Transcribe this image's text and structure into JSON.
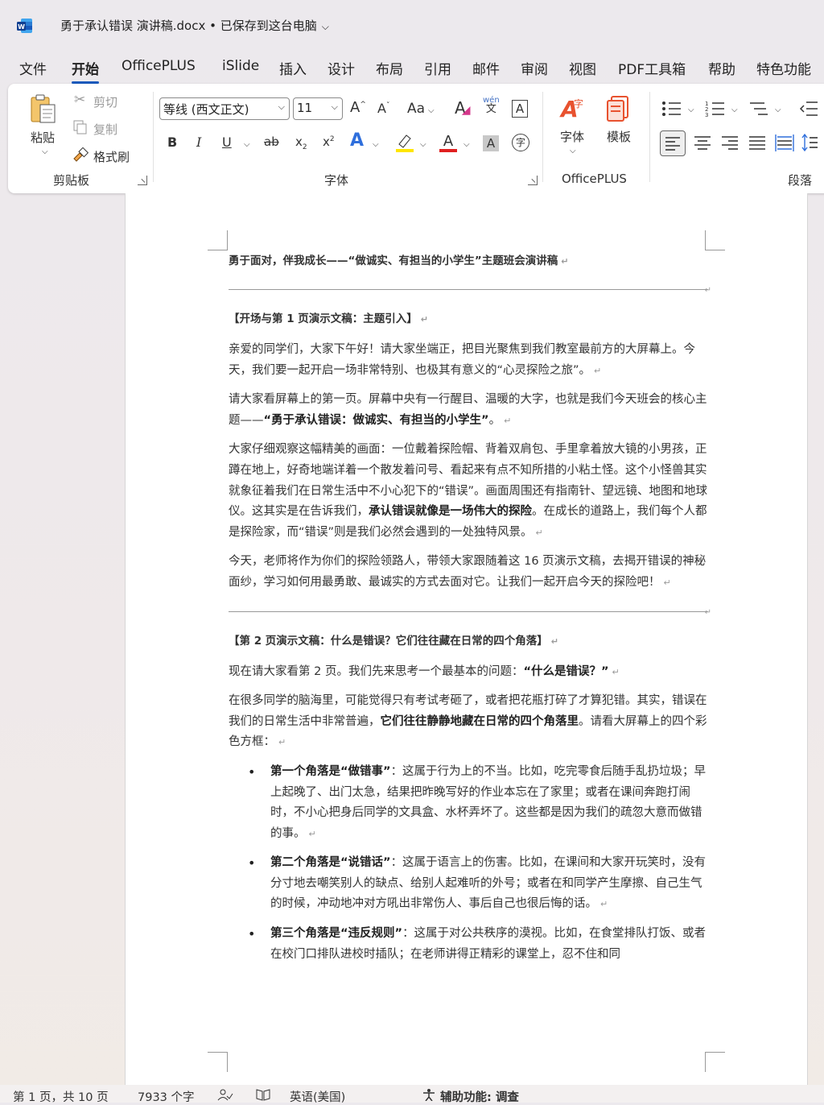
{
  "titlebar": {
    "doc_title": "勇于承认错误 演讲稿.docx • 已保存到这台电脑",
    "chevron": "⌵"
  },
  "menu": {
    "tabs": [
      "文件",
      "开始",
      "OfficePLUS",
      "iSlide",
      "插入",
      "设计",
      "布局",
      "引用",
      "邮件",
      "审阅",
      "视图",
      "PDF工具箱",
      "帮助",
      "特色功能"
    ],
    "active": "开始"
  },
  "ribbon": {
    "clipboard": {
      "paste": "粘贴",
      "cut": "剪切",
      "copy": "复制",
      "format_painter": "格式刷",
      "label": "剪贴板"
    },
    "font": {
      "font_name": "等线 (西文正文)",
      "font_size": "11",
      "aa": "Aa",
      "label": "字体",
      "highlight_color": "#ffe600",
      "font_color": "#e02020"
    },
    "officeplus": {
      "font_btn": "字体",
      "template_btn": "模板",
      "label": "OfficePLUS"
    },
    "paragraph": {
      "label": "段落"
    }
  },
  "doc": {
    "title": "勇于面对，伴我成长——“做诚实、有担当的小学生”主题班会演讲稿",
    "sec1_heading": "【开场与第 1 页演示文稿：主题引入】",
    "p1": "亲爱的同学们，大家下午好！请大家坐端正，把目光聚焦到我们教室最前方的大屏幕上。今天，我们要一起开启一场非常特别、也极其有意义的“心灵探险之旅”。",
    "p2_a": "请大家看屏幕上的第一页。屏幕中央有一行醒目、温暖的大字，也就是我们今天班会的核心主题——",
    "p2_b": "“勇于承认错误：做诚实、有担当的小学生”",
    "p2_c": "。",
    "p3_a": "大家仔细观察这幅精美的画面：一位戴着探险帽、背着双肩包、手里拿着放大镜的小男孩，正蹲在地上，好奇地端详着一个散发着问号、看起来有点不知所措的小粘土怪。这个小怪兽其实就象征着我们在日常生活中不小心犯下的“错误”。画面周围还有指南针、望远镜、地图和地球仪。这其实是在告诉我们，",
    "p3_b": "承认错误就像是一场伟大的探险",
    "p3_c": "。在成长的道路上，我们每个人都是探险家，而“错误”则是我们必然会遇到的一处独特风景。",
    "p4": "今天，老师将作为你们的探险领路人，带领大家跟随着这 16 页演示文稿，去揭开错误的神秘面纱，学习如何用最勇敢、最诚实的方式去面对它。让我们一起开启今天的探险吧！",
    "sec2_heading": "【第 2 页演示文稿：什么是错误？它们往往藏在日常的四个角落】",
    "p5_a": "现在请大家看第 2 页。我们先来思考一个最基本的问题：",
    "p5_b": "“什么是错误？”",
    "p6_a": "在很多同学的脑海里，可能觉得只有考试考砸了，或者把花瓶打碎了才算犯错。其实，错误在我们的日常生活中非常普遍，",
    "p6_b": "它们往往静静地藏在日常的四个角落里",
    "p6_c": "。请看大屏幕上的四个彩色方框：",
    "b1_a": "第一个角落是“做错事”",
    "b1_b": "：这属于行为上的不当。比如，吃完零食后随手乱扔垃圾；早上起晚了、出门太急，结果把昨晚写好的作业本忘在了家里；或者在课间奔跑打闹时，不小心把身后同学的文具盒、水杯弄坏了。这些都是因为我们的疏忽大意而做错的事。",
    "b2_a": "第二个角落是“说错话”",
    "b2_b": "：这属于语言上的伤害。比如，在课间和大家开玩笑时，没有分寸地去嘲笑别人的缺点、给别人起难听的外号；或者在和同学产生摩擦、自己生气的时候，冲动地冲对方吼出非常伤人、事后自己也很后悔的话。",
    "b3_a": "第三个角落是“违反规则”",
    "b3_b": "：这属于对公共秩序的漠视。比如，在食堂排队打饭、或者在校门口排队进校时插队；在老师讲得正精彩的课堂上，忍不住和同"
  },
  "status": {
    "page": "第 1 页，共 10 页",
    "words": "7933 个字",
    "lang": "英语(美国)",
    "accessibility": "辅助功能: 调查"
  }
}
